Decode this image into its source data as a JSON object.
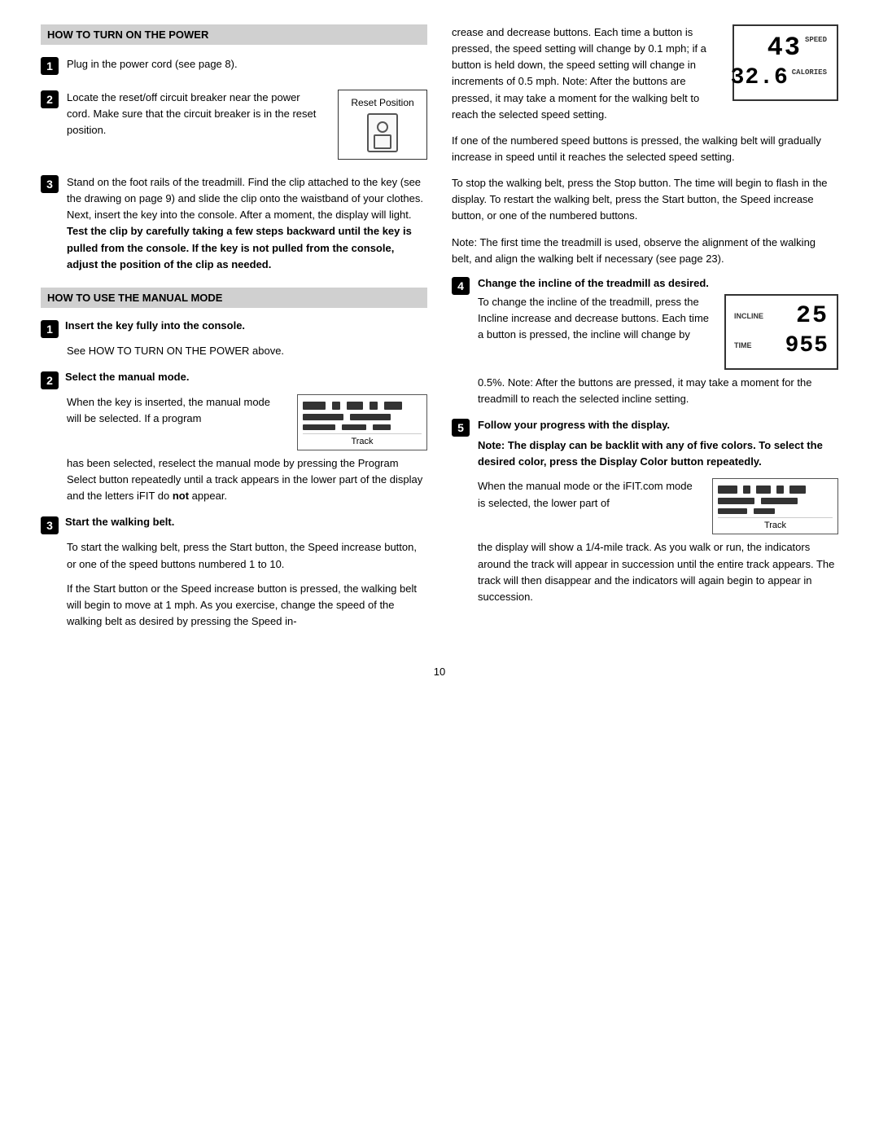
{
  "left": {
    "section1_title": "HOW TO TURN ON THE POWER",
    "steps": [
      {
        "num": "1",
        "text": "Plug in the power cord (see page 8)."
      },
      {
        "num": "2",
        "text_parts": [
          "Locate the reset/off circuit breaker near the power cord. Make sure that the circuit breaker is in the reset position."
        ],
        "reset_label": "Reset\nPosition"
      },
      {
        "num": "3",
        "text": "Stand on the foot rails of the treadmill. Find the clip attached to the key (see the drawing on page 9) and slide the clip onto the waistband of your clothes. Next, insert the key into the console. After a moment, the display will light. ",
        "bold_text": "Test the clip by carefully taking a few steps backward until the key is pulled from the console. If the key is not pulled from the console, adjust the position of the clip as needed."
      }
    ],
    "section2_title": "HOW TO USE THE MANUAL MODE",
    "manual_steps": [
      {
        "num": "1",
        "header": "Insert the key fully into the console.",
        "body": "See HOW TO TURN ON THE POWER above."
      },
      {
        "num": "2",
        "header": "Select the manual mode.",
        "body1": "When the key is inserted, the manual mode will be selected. If a program",
        "body2": "has been selected, reselect the manual mode by pressing the Program Select button repeatedly until a track appears in the lower part of the display and the letters iFIT do ",
        "body2_bold": "not",
        "body2_end": " appear.",
        "track_label": "Track"
      },
      {
        "num": "3",
        "header": "Start the walking belt.",
        "body1": "To start the walking belt, press the Start button, the Speed increase button, or one of the speed buttons numbered 1 to 10.",
        "body2": "If the Start button or the Speed increase button is pressed, the walking belt will begin to move at 1 mph. As you exercise, change the speed of the walking belt as desired by pressing the Speed in-"
      }
    ]
  },
  "right": {
    "para1": "crease and decrease buttons. Each time a button is pressed, the speed setting will change by 0.1 mph; if a button is held down, the speed setting will change in increments of 0.5 mph. Note: After the buttons are pressed, it may take a moment for the walking belt to reach the selected speed setting.",
    "speed_display": {
      "speed": "43",
      "speed_label": "SPEED",
      "calories": "32.6",
      "calories_label": "CALORIES"
    },
    "para2": "If one of the numbered speed buttons is pressed, the walking belt will gradually increase in speed until it reaches the selected speed setting.",
    "para3": "To stop the walking belt, press the Stop button. The time will begin to flash in the display. To restart the walking belt, press the Start button, the Speed increase button, or one of the numbered buttons.",
    "para4": "Note: The first time the treadmill is used, observe the alignment of the walking belt, and align the walking belt if necessary (see page 23).",
    "steps": [
      {
        "num": "4",
        "header": "Change the incline of the treadmill as desired.",
        "body1": "To change the incline of the treadmill, press the Incline increase and decrease buttons. Each time a button is pressed, the incline will change by",
        "body2": "0.5%. Note: After the buttons are pressed, it may take a moment for the treadmill to reach the selected incline setting.",
        "incline_val": "25",
        "incline_label": "INCLINE",
        "time_val": "955",
        "time_label": "TIME"
      },
      {
        "num": "5",
        "header": "Follow your progress with the display.",
        "bold_note": "Note: The display can be backlit with any of five colors. To select the desired color, press the Display Color button repeatedly.",
        "body1": "When the manual mode or the iFIT.com mode is selected, the lower part of",
        "body2": "the display will show a 1/4-mile track. As you walk or run, the indicators around the track will appear in succession until the entire track appears. The track will then disappear and the indicators will again begin to appear in succession.",
        "track_label": "Track"
      }
    ]
  },
  "page_number": "10"
}
